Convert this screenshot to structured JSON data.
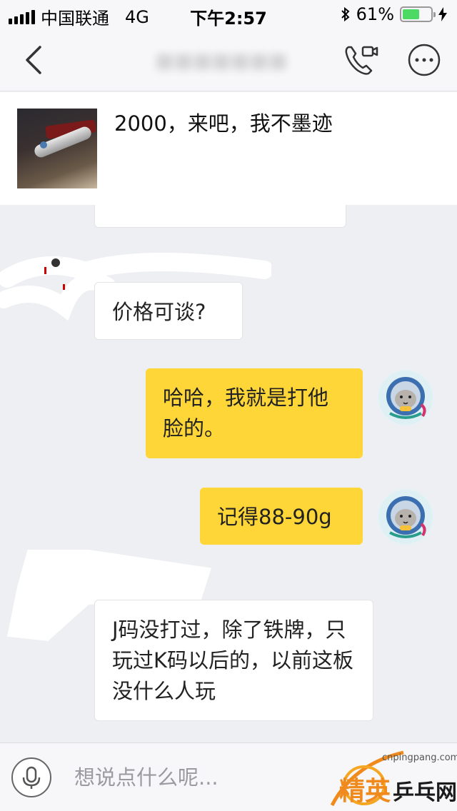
{
  "status_bar": {
    "carrier": "中国联通",
    "network": "4G",
    "time": "下午2:57",
    "battery_percent": "61%",
    "battery_level": 0.61
  },
  "nav": {
    "back_icon": "chevron-left-icon",
    "call_icon": "phone-video-icon",
    "more_icon": "more-icon"
  },
  "product": {
    "title": "2000，来吧，我不墨迹"
  },
  "messages": [
    {
      "side": "in",
      "text": "价格可谈?"
    },
    {
      "side": "out",
      "text": "哈哈，我就是打他脸的。"
    },
    {
      "side": "out",
      "text": "记得88-90g"
    },
    {
      "side": "in",
      "text": "J码没打过，除了铁牌，只玩过K码以后的，以前这板没什么人玩"
    }
  ],
  "input": {
    "placeholder": "想说点什么呢...",
    "mic_icon": "microphone-icon"
  },
  "watermark": {
    "url": "cnpingpang.com",
    "logo_text": "精英乒乓网"
  },
  "colors": {
    "background": "#eeeff3",
    "outgoing_bubble": "#fed637",
    "incoming_bubble": "#ffffff",
    "battery_fill": "#4cd964"
  }
}
